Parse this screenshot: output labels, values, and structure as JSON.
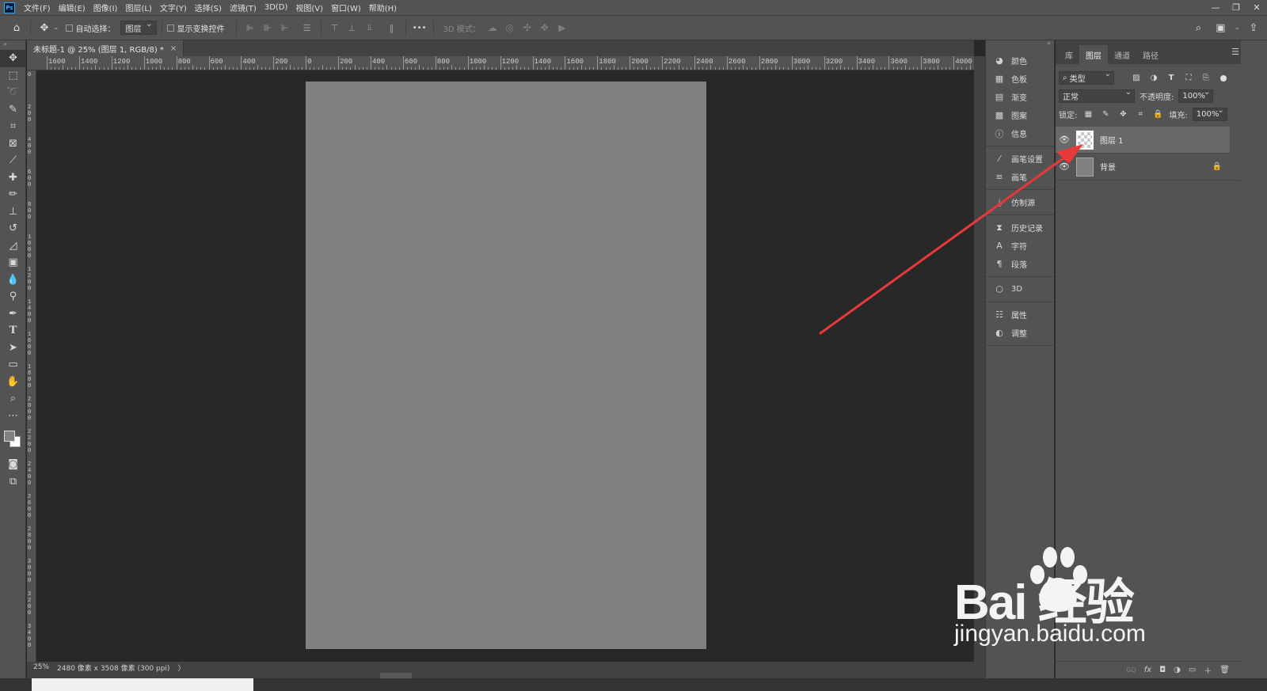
{
  "menubar": {
    "logo": "Ps",
    "items": [
      "文件(F)",
      "编辑(E)",
      "图像(I)",
      "图层(L)",
      "文字(Y)",
      "选择(S)",
      "滤镜(T)",
      "3D(D)",
      "视图(V)",
      "窗口(W)",
      "帮助(H)"
    ],
    "window_controls": [
      "—",
      "❐",
      "✕"
    ]
  },
  "options": {
    "auto_select_label": "自动选择：",
    "auto_select_value": "图层",
    "show_transform_label": "显示变换控件",
    "more": "•••",
    "mode_3d_label": "3D 模式："
  },
  "document": {
    "tab_title": "未标题-1 @ 25% (图层 1, RGB/8) *",
    "tab_close": "×",
    "canvas_color": "#808080",
    "ruler_h_labels": [
      "1600",
      "1400",
      "1200",
      "1000",
      "800",
      "600",
      "400",
      "200",
      "0",
      "200",
      "400",
      "600",
      "800",
      "1000",
      "1200",
      "1400",
      "1600",
      "1800",
      "2000",
      "2200",
      "2400",
      "2600",
      "2800",
      "3000",
      "3200",
      "3400",
      "3600",
      "3800",
      "4000"
    ],
    "ruler_v_labels": [
      "0",
      "200",
      "400",
      "600",
      "800",
      "1000",
      "1200",
      "1400",
      "1600",
      "1800",
      "2000",
      "2200",
      "2400",
      "2600",
      "2800",
      "3000",
      "3200",
      "3400"
    ]
  },
  "status": {
    "zoom": "25%",
    "info": "2480 像素 x 3508 像素 (300 ppi)",
    "arrow": "〉"
  },
  "dock": {
    "groups": [
      [
        {
          "icon": "color-palette-icon",
          "glyph": "◕",
          "label": "颜色"
        },
        {
          "icon": "swatches-icon",
          "glyph": "▦",
          "label": "色板"
        },
        {
          "icon": "gradient-icon",
          "glyph": "▤",
          "label": "渐变"
        },
        {
          "icon": "pattern-icon",
          "glyph": "▩",
          "label": "图案"
        },
        {
          "icon": "info-icon",
          "glyph": "ⓘ",
          "label": "信息"
        }
      ],
      [
        {
          "icon": "brush-settings-icon",
          "glyph": "⁄",
          "label": "画笔设置"
        },
        {
          "icon": "brushes-icon",
          "glyph": "≡",
          "label": "画笔"
        }
      ],
      [
        {
          "icon": "clone-source-icon",
          "glyph": "⍊",
          "label": "仿制源"
        }
      ],
      [
        {
          "icon": "history-icon",
          "glyph": "⧗",
          "label": "历史记录"
        },
        {
          "icon": "character-icon",
          "glyph": "A",
          "label": "字符"
        },
        {
          "icon": "paragraph-icon",
          "glyph": "¶",
          "label": "段落"
        }
      ],
      [
        {
          "icon": "3d-cube-icon",
          "glyph": "⬡",
          "label": "3D"
        }
      ],
      [
        {
          "icon": "properties-icon",
          "glyph": "☷",
          "label": "属性"
        },
        {
          "icon": "adjustments-icon",
          "glyph": "◐",
          "label": "调整"
        }
      ]
    ]
  },
  "layers_panel": {
    "tabs": [
      {
        "label": "库",
        "active": false
      },
      {
        "label": "图层",
        "active": true
      },
      {
        "label": "通道",
        "active": false
      },
      {
        "label": "路径",
        "active": false
      }
    ],
    "filter_label": "类型",
    "blend_mode": "正常",
    "opacity_label": "不透明度:",
    "opacity_value": "100%",
    "lock_label": "锁定:",
    "fill_label": "填充:",
    "fill_value": "100%",
    "layers": [
      {
        "name": "图层 1",
        "selected": true,
        "thumb": "transparent",
        "locked": false
      },
      {
        "name": "背景",
        "selected": false,
        "thumb": "gray",
        "locked": true
      }
    ],
    "footer_icons": [
      "GO",
      "fx",
      "◘",
      "◑",
      "▭",
      "＋",
      "🗑"
    ]
  },
  "annotation": {
    "arrow_color": "#e8393a"
  },
  "watermark": {
    "logo_text": "Bai  经验",
    "url": "jingyan.baidu.com"
  }
}
